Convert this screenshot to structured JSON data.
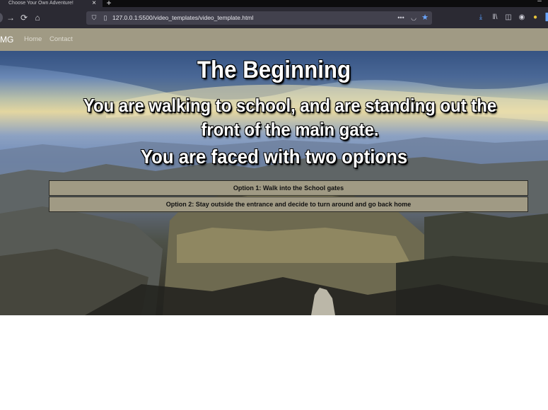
{
  "browser": {
    "tab_title": "Choose Your Own Adventure!",
    "url": "127.0.0.1:5500/video_templates/video_template.html"
  },
  "site": {
    "brand": "MG",
    "nav": [
      "Home",
      "Contact"
    ]
  },
  "story": {
    "title": "The Beginning",
    "scenario": "You are walking to school, and are standing out the front of the main gate.",
    "prompt": "You are faced with two options",
    "options": [
      "Option 1: Walk into the School gates",
      "Option 2: Stay outside the entrance and decide to turn around and go back home"
    ]
  },
  "colors": {
    "header": "#a09a84",
    "button": "#a09a84",
    "browser_chrome": "#2b2a33"
  },
  "icons": [
    "close-icon",
    "plus-icon",
    "back-icon",
    "forward-icon",
    "reload-icon",
    "home-icon",
    "shield-icon",
    "page-icon",
    "more-icon",
    "pocket-icon",
    "star-icon",
    "download-icon",
    "library-icon",
    "sidebar-icon",
    "account-icon",
    "extension-icon"
  ]
}
